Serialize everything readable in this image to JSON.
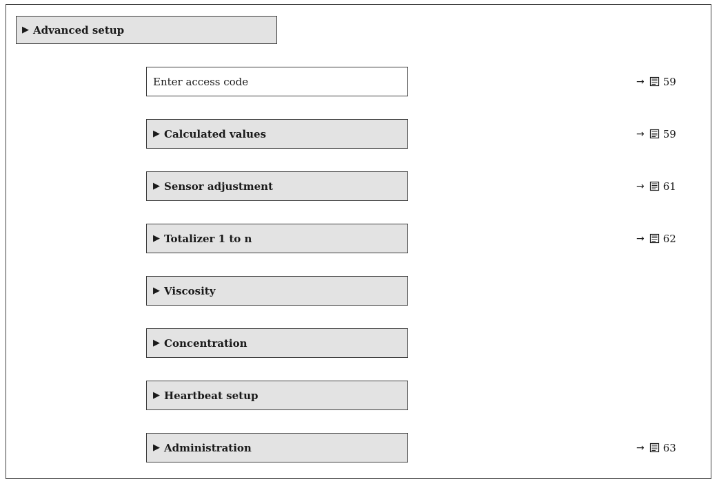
{
  "header": {
    "arrow": "▶",
    "label": "Advanced setup"
  },
  "items": [
    {
      "kind": "parameter",
      "label": "Enter access code",
      "ref_arrow": "→",
      "ref_page": "59"
    },
    {
      "kind": "submenu",
      "arrow": "▶",
      "label": "Calculated values",
      "ref_arrow": "→",
      "ref_page": "59"
    },
    {
      "kind": "submenu",
      "arrow": "▶",
      "label": "Sensor adjustment",
      "ref_arrow": "→",
      "ref_page": "61"
    },
    {
      "kind": "submenu",
      "arrow": "▶",
      "label": "Totalizer 1 to n",
      "ref_arrow": "→",
      "ref_page": "62"
    },
    {
      "kind": "submenu",
      "arrow": "▶",
      "label": "Viscosity"
    },
    {
      "kind": "submenu",
      "arrow": "▶",
      "label": "Concentration"
    },
    {
      "kind": "submenu",
      "arrow": "▶",
      "label": "Heartbeat setup"
    },
    {
      "kind": "submenu",
      "arrow": "▶",
      "label": "Administration",
      "ref_arrow": "→",
      "ref_page": "63"
    }
  ],
  "icons": {
    "page_reference": "book-icon",
    "submenu_marker": "triangle-right-icon"
  },
  "colors": {
    "submenu_fill": "#e3e3e3",
    "border": "#3c3c3c"
  }
}
